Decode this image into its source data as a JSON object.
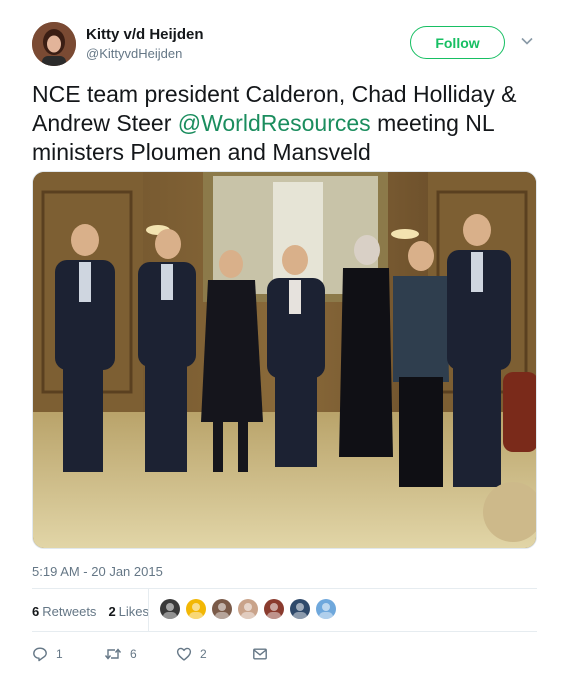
{
  "author": {
    "display_name": "Kitty v/d Heijden",
    "handle": "@KittyvdHeijden"
  },
  "follow_label": "Follow",
  "tweet": {
    "text_before": "NCE team president Calderon, Chad Holliday & Andrew Steer ",
    "mention": "@WorldResources",
    "text_after": " meeting NL ministers Ploumen and Mansveld"
  },
  "timestamp": "5:19 AM - 20 Jan 2015",
  "stats": {
    "retweets_count": "6",
    "retweets_label": "Retweets",
    "likes_count": "2",
    "likes_label": "Likes"
  },
  "liker_avatars": [
    {
      "color": "#3a3a3a",
      "icon": "avatar-dark-silhouette"
    },
    {
      "color": "#f2b705",
      "icon": "avatar-gold-pattern"
    },
    {
      "color": "#7a5a48",
      "icon": "avatar-person"
    },
    {
      "color": "#c9a38a",
      "icon": "avatar-person"
    },
    {
      "color": "#8a3b2e",
      "icon": "avatar-person"
    },
    {
      "color": "#2f4a6b",
      "icon": "avatar-person"
    },
    {
      "color": "#6fa8dc",
      "icon": "avatar-person"
    }
  ],
  "actions": {
    "replies": "1",
    "retweets": "6",
    "likes": "2"
  },
  "colors": {
    "accent": "#17bf63",
    "mention": "#1b8d5e",
    "secondary_text": "#657786"
  }
}
